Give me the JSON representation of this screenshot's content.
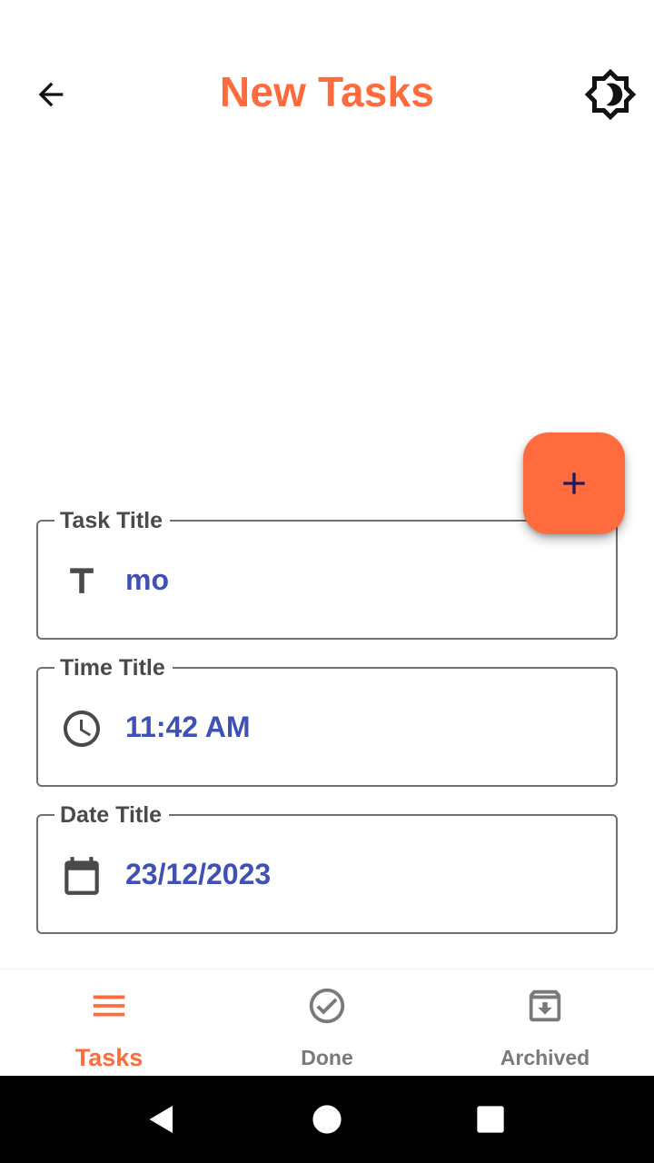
{
  "header": {
    "title": "New Tasks",
    "back_icon": "arrow-back-icon",
    "theme_icon": "brightness-icon"
  },
  "fab": {
    "icon": "plus-icon"
  },
  "form": {
    "task_title": {
      "label": "Task Title",
      "value": "mo",
      "icon": "title-icon"
    },
    "time_title": {
      "label": "Time Title",
      "value": "11:42 AM",
      "icon": "clock-icon"
    },
    "date_title": {
      "label": "Date Title",
      "value": "23/12/2023",
      "icon": "calendar-icon"
    }
  },
  "bottom_nav": {
    "items": [
      {
        "label": "Tasks",
        "icon": "menu-icon",
        "active": true
      },
      {
        "label": "Done",
        "icon": "check-circle-icon",
        "active": false
      },
      {
        "label": "Archived",
        "icon": "archive-icon",
        "active": false
      }
    ]
  },
  "colors": {
    "accent": "#ff6b3d",
    "value_text": "#3f51b5",
    "label_text": "#4a4a4a",
    "inactive_nav": "#7a7a7a"
  }
}
